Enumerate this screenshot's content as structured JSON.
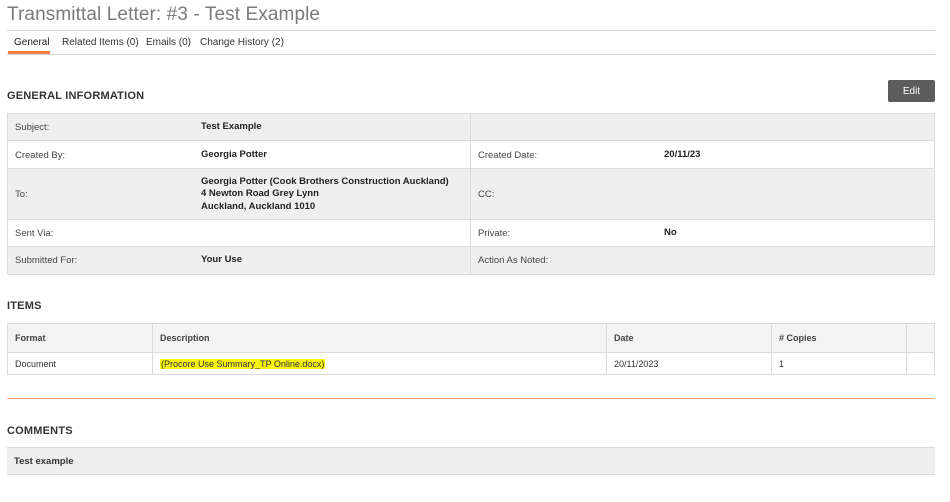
{
  "page": {
    "title": "Transmittal Letter: #3 - Test Example"
  },
  "tabs": [
    {
      "label": "General",
      "active": true
    },
    {
      "label": "Related Items (0)"
    },
    {
      "label": "Emails (0)"
    },
    {
      "label": "Change History (2)"
    }
  ],
  "accent_color": "#f47e42",
  "actions": {
    "edit_label": "Edit"
  },
  "general": {
    "section_title": "GENERAL INFORMATION",
    "subject_label": "Subject:",
    "subject_value": "Test Example",
    "created_by_label": "Created By:",
    "created_by_value": "Georgia Potter",
    "created_date_label": "Created Date:",
    "created_date_value": "20/11/23",
    "to_label": "To:",
    "to_line1": "Georgia Potter (Cook Brothers Construction Auckland)",
    "to_line2": "4 Newton Road Grey Lynn",
    "to_line3": "Auckland, Auckland 1010",
    "cc_label": "CC:",
    "sent_via_label": "Sent Via:",
    "private_label": "Private:",
    "private_value": "No",
    "submitted_for_label": "Submitted For:",
    "submitted_for_value": "Your Use",
    "action_as_noted_label": "Action As Noted:"
  },
  "items": {
    "section_title": "ITEMS",
    "columns": [
      "Format",
      "Description",
      "Date",
      "# Copies"
    ],
    "rows": [
      {
        "format": "Document",
        "description": "(Procore Use Summary_TP Online.docx)",
        "date": "20/11/2023",
        "copies": "1"
      }
    ]
  },
  "comments": {
    "section_title": "COMMENTS",
    "text": "Test example"
  }
}
